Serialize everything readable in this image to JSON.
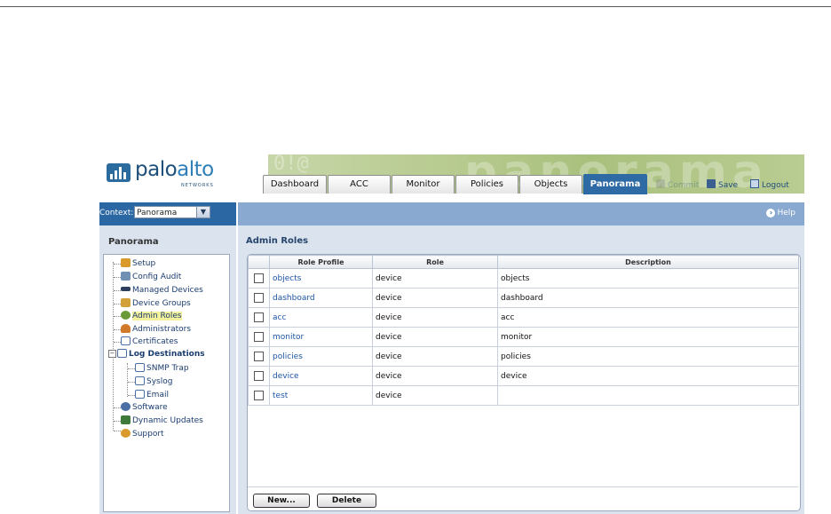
{
  "brand": {
    "logo_main": "palo",
    "logo_accent": "alto",
    "logo_sub": "NETWORKS",
    "banner_word": "panorama",
    "banner_prefix": "0!@"
  },
  "tabs": [
    {
      "label": "Dashboard",
      "active": false
    },
    {
      "label": "ACC",
      "active": false
    },
    {
      "label": "Monitor",
      "active": false
    },
    {
      "label": "Policies",
      "active": false
    },
    {
      "label": "Objects",
      "active": false
    },
    {
      "label": "Panorama",
      "active": true
    }
  ],
  "toolbar": {
    "commit_label": "Commit",
    "save_label": "Save",
    "logout_label": "Logout"
  },
  "context": {
    "label": "Context:",
    "value": "Panorama"
  },
  "help": {
    "label": "Help"
  },
  "sidebar": {
    "title": "Panorama",
    "items": [
      {
        "label": "Setup",
        "icon": "setup-icon",
        "color": "#d89a2a"
      },
      {
        "label": "Config Audit",
        "icon": "config-audit-icon",
        "color": "#6f8fb3"
      },
      {
        "label": "Managed Devices",
        "icon": "managed-devices-icon",
        "color": "#2d3f5c"
      },
      {
        "label": "Device Groups",
        "icon": "device-groups-icon",
        "color": "#d2a13a"
      },
      {
        "label": "Admin Roles",
        "icon": "admin-roles-icon",
        "color": "#6b9a3a",
        "selected": true
      },
      {
        "label": "Administrators",
        "icon": "administrators-icon",
        "color": "#d07a2a"
      },
      {
        "label": "Certificates",
        "icon": "certificates-icon",
        "color": "#4a6fa5"
      },
      {
        "label": "Log Destinations",
        "icon": "log-destinations-icon",
        "color": "#4a6fa5",
        "group": true
      },
      {
        "label": "SNMP Trap",
        "icon": "snmp-trap-icon",
        "color": "#4a6fa5",
        "child": true
      },
      {
        "label": "Syslog",
        "icon": "syslog-icon",
        "color": "#4a6fa5",
        "child": true
      },
      {
        "label": "Email",
        "icon": "email-icon",
        "color": "#4a6fa5",
        "child": true
      },
      {
        "label": "Software",
        "icon": "software-icon",
        "color": "#4a6fa5"
      },
      {
        "label": "Dynamic Updates",
        "icon": "dynamic-updates-icon",
        "color": "#3f7a3a"
      },
      {
        "label": "Support",
        "icon": "support-icon",
        "color": "#d89a2a"
      }
    ]
  },
  "main": {
    "title": "Admin Roles",
    "columns": [
      "Role Profile",
      "Role",
      "Description"
    ],
    "rows": [
      {
        "profile": "objects",
        "role": "device",
        "description": "objects"
      },
      {
        "profile": "dashboard",
        "role": "device",
        "description": "dashboard"
      },
      {
        "profile": "acc",
        "role": "device",
        "description": "acc"
      },
      {
        "profile": "monitor",
        "role": "device",
        "description": "monitor"
      },
      {
        "profile": "policies",
        "role": "device",
        "description": "policies"
      },
      {
        "profile": "device",
        "role": "device",
        "description": "device"
      },
      {
        "profile": "test",
        "role": "device",
        "description": ""
      }
    ],
    "buttons": {
      "new": "New...",
      "delete": "Delete"
    }
  }
}
